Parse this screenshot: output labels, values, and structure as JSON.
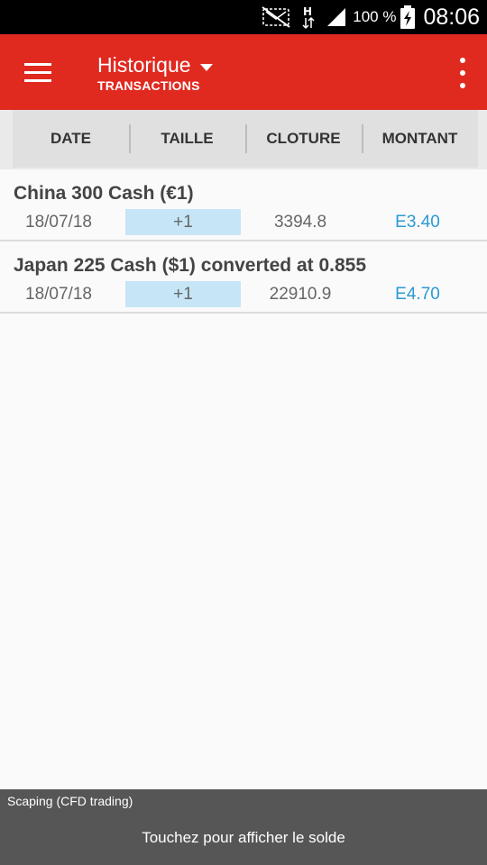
{
  "status_bar": {
    "battery_percent": "100 %",
    "time": "08:06",
    "network_type": "H",
    "icons": [
      "mute-icon",
      "h-network-icon",
      "signal-icon",
      "battery-charging-icon"
    ]
  },
  "app_bar": {
    "title": "Historique",
    "subtitle": "TRANSACTIONS",
    "icons": [
      "menu-icon",
      "dropdown-caret-icon",
      "overflow-menu-icon"
    ],
    "color": "#e02a20"
  },
  "columns": [
    "DATE",
    "TAILLE",
    "CLOTURE",
    "MONTANT"
  ],
  "transactions": [
    {
      "name": "China 300 Cash (€1)",
      "date": "18/07/18",
      "size": "+1",
      "close": "3394.8",
      "amount": "E3.40"
    },
    {
      "name": "Japan 225 Cash ($1) converted at 0.855",
      "date": "18/07/18",
      "size": "+1",
      "close": "22910.9",
      "amount": "E4.70"
    }
  ],
  "footer": {
    "account": "Scaping (CFD trading)",
    "action": "Touchez pour afficher le solde"
  },
  "colors": {
    "accent": "#e02a20",
    "amount": "#2a9ad5",
    "size_highlight": "#c6e5f6",
    "footer": "#565656"
  }
}
